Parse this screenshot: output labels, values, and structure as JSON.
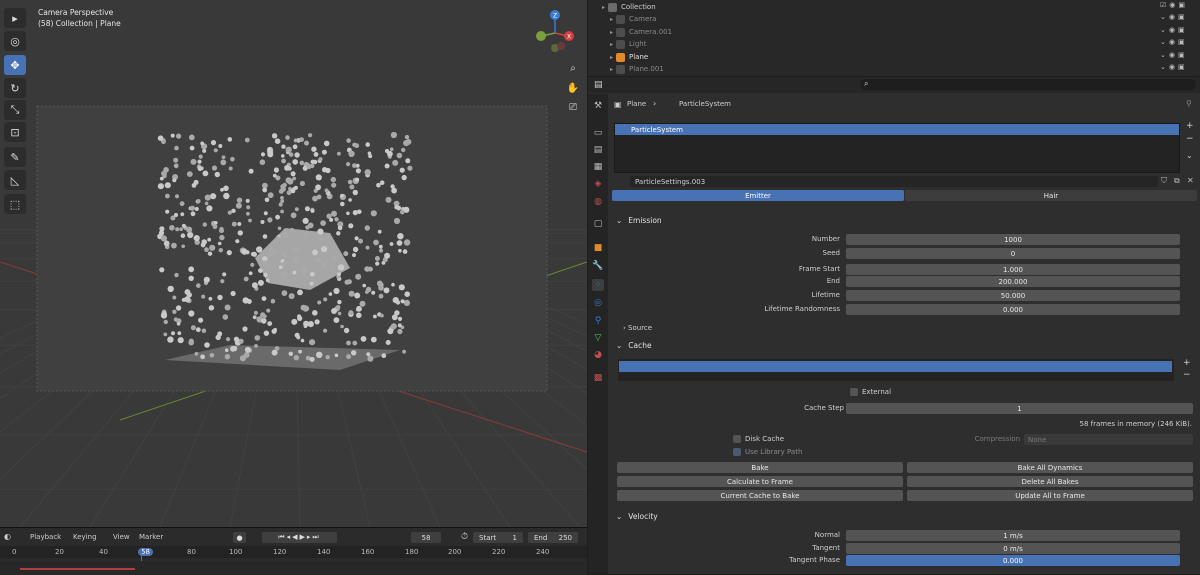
{
  "viewport": {
    "title": "Camera Perspective",
    "subtitle": "(58) Collection | Plane",
    "gizmo": {
      "z": "Z",
      "x": "X",
      "y": "Y"
    }
  },
  "timeline": {
    "menus": [
      "Playback",
      "Keying",
      "View",
      "Marker"
    ],
    "current_frame": "58",
    "start_label": "Start",
    "start": "1",
    "end_label": "End",
    "end": "250",
    "ticks": [
      "0",
      "20",
      "40",
      "58",
      "80",
      "100",
      "120",
      "140",
      "160",
      "180",
      "200",
      "220",
      "240"
    ]
  },
  "outliner": {
    "rows": [
      {
        "name": "Collection",
        "color": "#cfcfcf"
      },
      {
        "name": "Camera",
        "color": "#8a8a8a"
      },
      {
        "name": "Camera.001",
        "color": "#8a8a8a"
      },
      {
        "name": "Light",
        "color": "#8a8a8a"
      },
      {
        "name": "Plane",
        "color": "#e0e0e0"
      },
      {
        "name": "Plane.001",
        "color": "#8a8a8a"
      }
    ]
  },
  "properties": {
    "breadcrumb": {
      "object": "Plane",
      "system": "ParticleSystem"
    },
    "particle_system": "ParticleSystem",
    "settings_name": "ParticleSettings.003",
    "tabs": {
      "emitter": "Emitter",
      "hair": "Hair"
    },
    "emission": {
      "header": "Emission",
      "fields": [
        {
          "label": "Number",
          "value": "1000"
        },
        {
          "label": "Seed",
          "value": "0"
        },
        {
          "label": "Frame Start",
          "value": "1.000"
        },
        {
          "label": "End",
          "value": "200.000"
        },
        {
          "label": "Lifetime",
          "value": "50.000"
        },
        {
          "label": "Lifetime Randomness",
          "value": "0.000"
        }
      ],
      "source": "Source"
    },
    "cache": {
      "header": "Cache",
      "external": "External",
      "cache_step_label": "Cache Step",
      "cache_step": "1",
      "memory": "58 frames in memory (246 KiB).",
      "disk_cache": "Disk Cache",
      "use_library_path": "Use Library Path",
      "compression_label": "Compression",
      "compression": "None",
      "buttons": [
        "Bake",
        "Bake All Dynamics",
        "Calculate to Frame",
        "Delete All Bakes",
        "Current Cache to Bake",
        "Update All to Frame"
      ]
    },
    "velocity": {
      "header": "Velocity",
      "fields": [
        {
          "label": "Normal",
          "value": "1 m/s"
        },
        {
          "label": "Tangent",
          "value": "0 m/s"
        },
        {
          "label": "Tangent Phase",
          "value": "0.000"
        }
      ]
    }
  },
  "colors": {
    "accent": "#4772b3",
    "field": "#545454",
    "panel": "#2e2e2e"
  }
}
